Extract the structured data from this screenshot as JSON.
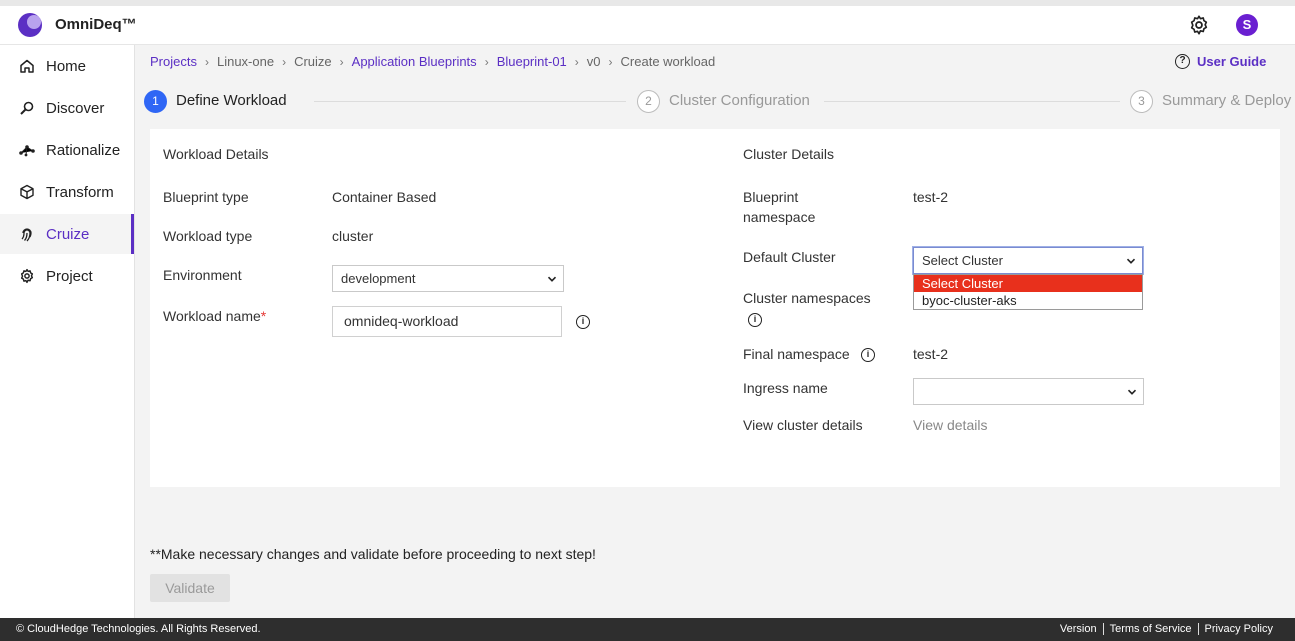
{
  "app": {
    "brand": "OmniDeq™",
    "avatar_letter": "S",
    "accent": "#5b2fc4"
  },
  "sidebar": {
    "items": [
      {
        "label": "Home",
        "icon": "home-icon"
      },
      {
        "label": "Discover",
        "icon": "discover-icon"
      },
      {
        "label": "Rationalize",
        "icon": "rationalize-icon"
      },
      {
        "label": "Transform",
        "icon": "cube-icon"
      },
      {
        "label": "Cruize",
        "icon": "fingerprint-icon",
        "active": true
      },
      {
        "label": "Project",
        "icon": "gear-icon"
      }
    ]
  },
  "breadcrumb": [
    {
      "label": "Projects",
      "link": true
    },
    {
      "label": "Linux-one",
      "link": false
    },
    {
      "label": "Cruize",
      "link": false
    },
    {
      "label": "Application Blueprints",
      "link": true
    },
    {
      "label": "Blueprint-01",
      "link": true
    },
    {
      "label": "v0",
      "link": false
    },
    {
      "label": "Create workload",
      "link": false
    }
  ],
  "user_guide": "User Guide",
  "steps": [
    {
      "num": "1",
      "label": "Define Workload"
    },
    {
      "num": "2",
      "label": "Cluster Configuration"
    },
    {
      "num": "3",
      "label": "Summary & Deploy"
    }
  ],
  "workload": {
    "title": "Workload Details",
    "blueprint_type_label": "Blueprint type",
    "blueprint_type": "Container Based",
    "workload_type_label": "Workload type",
    "workload_type": "cluster",
    "environment_label": "Environment",
    "environment": "development",
    "name_label": "Workload name",
    "required_mark": "*",
    "name_value": "omnideq-workload"
  },
  "cluster": {
    "title": "Cluster Details",
    "bp_ns_label_1": "Blueprint",
    "bp_ns_label_2": "namespace",
    "bp_ns_value": "test-2",
    "default_cluster_label": "Default Cluster",
    "default_cluster_value": "Select Cluster",
    "cluster_options": [
      "Select Cluster",
      "byoc-cluster-aks"
    ],
    "cluster_ns_label": "Cluster namespaces",
    "final_ns_label": "Final namespace",
    "final_ns_value": "test-2",
    "ingress_label": "Ingress name",
    "ingress_value": "",
    "view_label": "View cluster details",
    "view_link": "View details"
  },
  "note": "**Make necessary changes and validate before proceeding to next step!",
  "validate_label": "Validate",
  "footer": {
    "copyright": "© CloudHedge Technologies. All Rights Reserved.",
    "links": [
      "Version",
      "Terms of Service",
      "Privacy Policy"
    ]
  }
}
